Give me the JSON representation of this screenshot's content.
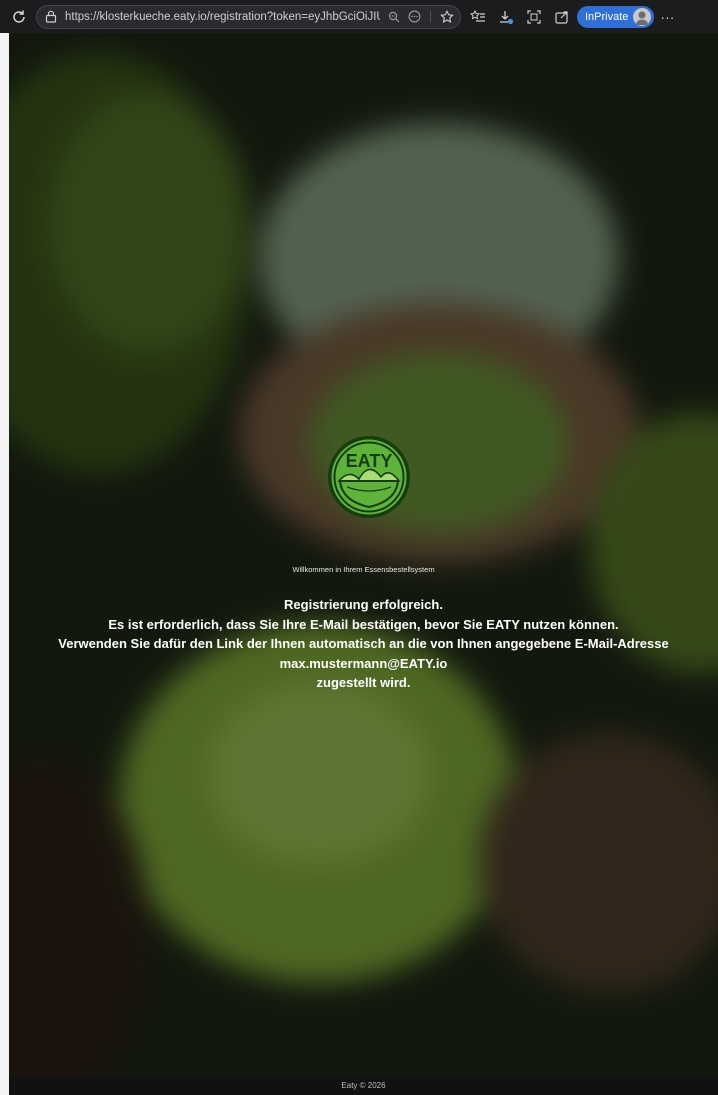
{
  "browser": {
    "url": "https://klosterkueche.eaty.io/registration?token=eyJhbGciOiJIUzI1...",
    "inprivate_label": "InPrivate"
  },
  "logo": {
    "text": "EATY",
    "colors": {
      "green": "#5fb33a",
      "dark": "#163d10",
      "light": "#a7dc74"
    }
  },
  "page": {
    "welcome": "Willkommen in Ihrem Essensbestellsystem",
    "lines": [
      "Registrierung erfolgreich.",
      "Es ist erforderlich, dass Sie Ihre E-Mail bestätigen, bevor Sie EATY nutzen können.",
      "Verwenden Sie dafür den Link der Ihnen automatisch an die von Ihnen angegebene E-Mail-Adresse",
      "max.mustermann@EATY.io",
      "zugestellt wird."
    ],
    "footer": "Eaty © 2026"
  }
}
